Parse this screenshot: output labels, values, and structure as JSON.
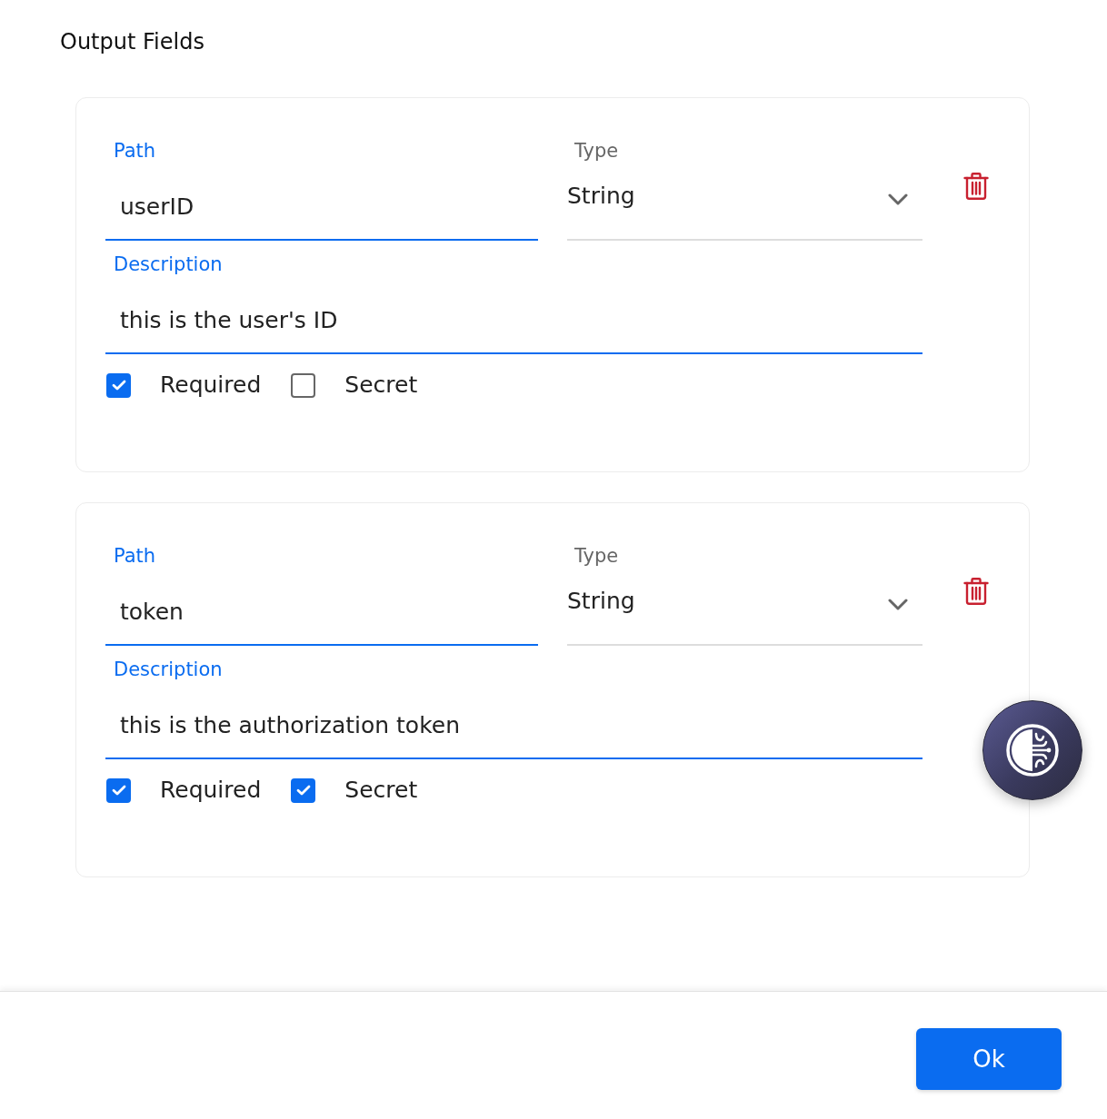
{
  "title": "Output Fields",
  "fields": [
    {
      "path_label": "Path",
      "path": "userID",
      "type_label": "Type",
      "type": "String",
      "description_label": "Description",
      "description": "this is the user's ID",
      "required_label": "Required",
      "required": true,
      "secret_label": "Secret",
      "secret": false
    },
    {
      "path_label": "Path",
      "path": "token",
      "type_label": "Type",
      "type": "String",
      "description_label": "Description",
      "description": "this is the authorization token",
      "required_label": "Required",
      "required": true,
      "secret_label": "Secret",
      "secret": true
    }
  ],
  "footer": {
    "ok_button": "Ok"
  }
}
